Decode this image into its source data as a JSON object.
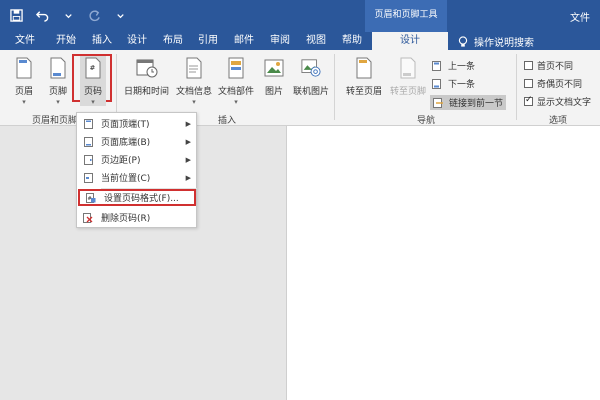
{
  "titlebar": {
    "context_tools": "页眉和页脚工具",
    "file_right": "文件"
  },
  "tabs": [
    "文件",
    "开始",
    "插入",
    "设计",
    "布局",
    "引用",
    "邮件",
    "审阅",
    "视图",
    "帮助"
  ],
  "active_tab": "设计",
  "tell_me": "操作说明搜索",
  "ribbon": {
    "header_btn": "页眉",
    "footer_btn": "页脚",
    "page_number_btn": "页码",
    "date_time_btn": "日期和时间",
    "doc_info_btn": "文档信息",
    "doc_parts_btn": "文档部件",
    "picture_btn": "图片",
    "online_picture_btn": "联机图片",
    "goto_header_btn": "转至页眉",
    "goto_footer_btn": "转至页脚",
    "prev_btn": "上一条",
    "next_btn": "下一条",
    "link_prev_btn": "链接到前一节",
    "opt_first_page": "首页不同",
    "opt_odd_even": "奇偶页不同",
    "opt_show_text": "显示文档文字",
    "group_header_footer": "页眉和页脚",
    "group_insert": "插入",
    "group_nav": "导航",
    "group_options": "选项"
  },
  "menu": {
    "top_of_page": "页面顶端(T)",
    "bottom_of_page": "页面底端(B)",
    "page_margins": "页边距(P)",
    "current_position": "当前位置(C)",
    "format_page_numbers": "设置页码格式(F)...",
    "remove_page_numbers": "删除页码(R)"
  },
  "colors": {
    "title_blue": "#2b579a",
    "highlight_red": "#d03030"
  }
}
